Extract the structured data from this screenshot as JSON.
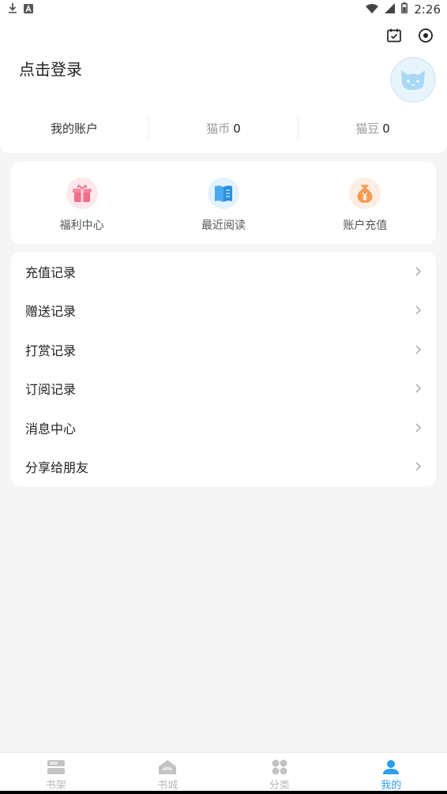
{
  "status_bar": {
    "time": "2:26",
    "left_icons": [
      "download-icon",
      "notification-a-icon"
    ],
    "right_icons": [
      "wifi-icon",
      "signal-icon",
      "battery-icon"
    ]
  },
  "header": {
    "login_text": "点击登录",
    "top_icons": [
      "calendar-check-icon",
      "settings-dot-icon"
    ],
    "avatar": "cat-avatar-icon",
    "stats": {
      "account_label": "我的账户",
      "coins_label": "猫币",
      "coins_value": "0",
      "beans_label": "猫豆",
      "beans_value": "0"
    }
  },
  "quick_actions": [
    {
      "label": "福利中心",
      "icon": "gift-icon"
    },
    {
      "label": "最近阅读",
      "icon": "book-icon"
    },
    {
      "label": "账户充值",
      "icon": "money-bag-icon"
    }
  ],
  "menu": [
    {
      "label": "充值记录"
    },
    {
      "label": "赠送记录"
    },
    {
      "label": "打赏记录"
    },
    {
      "label": "订阅记录"
    },
    {
      "label": "消息中心"
    },
    {
      "label": "分享给朋友"
    }
  ],
  "bottom_nav": [
    {
      "label": "书架",
      "icon": "bookshelf-icon",
      "active": false
    },
    {
      "label": "书城",
      "icon": "bookstore-icon",
      "active": false
    },
    {
      "label": "分类",
      "icon": "category-icon",
      "active": false
    },
    {
      "label": "我的",
      "icon": "profile-icon",
      "active": true
    }
  ],
  "colors": {
    "accent": "#2b9ef2",
    "inactive": "#b9b9b9",
    "background": "#f5f5f5"
  }
}
